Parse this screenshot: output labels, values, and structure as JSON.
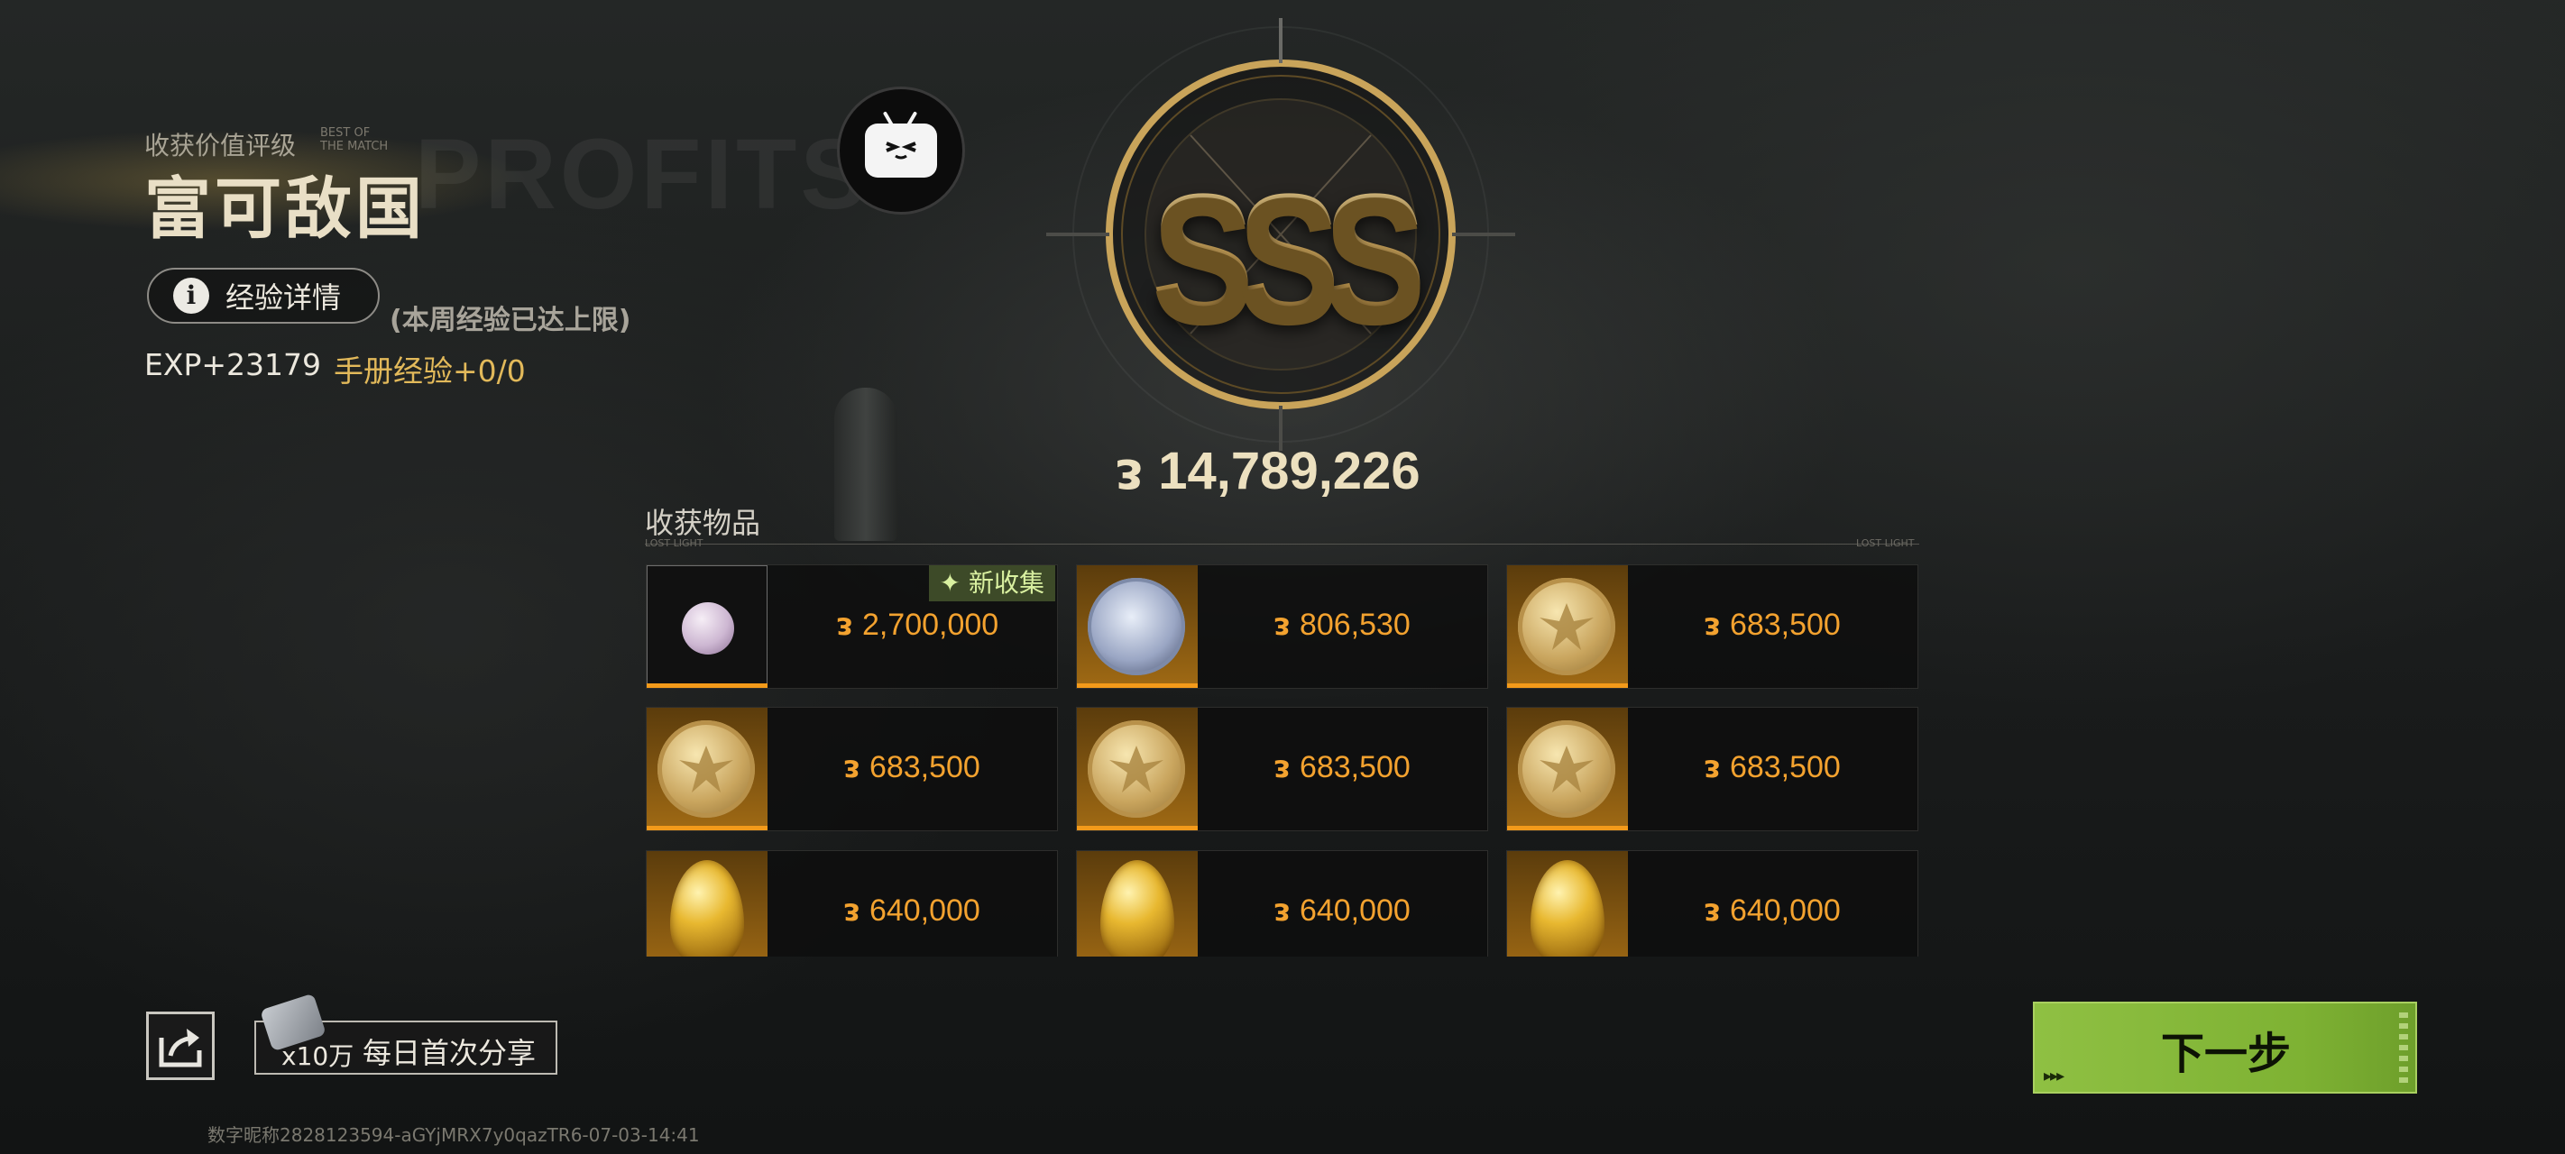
{
  "rating": {
    "label": "收获价值评级",
    "deco_line1": "BEST OF",
    "deco_line2": "THE MATCH",
    "title": "富可敌国",
    "grade": "SSS"
  },
  "background_word": "PROFITS",
  "experience": {
    "details_button": "经验详情",
    "limit_note": "(本周经验已达上限)",
    "exp": "EXP+23179",
    "manual_exp": "手册经验+0/0"
  },
  "total_value": "14,789,226",
  "currency_glyph": "ᴈ",
  "items": {
    "title": "收获物品",
    "rule_left": "LOST LIGHT",
    "rule_right": "LOST LIGHT",
    "new_tag": "✦ 新收集",
    "list": [
      {
        "name": "pebble",
        "price": "2,700,000"
      },
      {
        "name": "portrait-coin",
        "price": "806,530"
      },
      {
        "name": "gold-coin",
        "price": "683,500"
      },
      {
        "name": "gold-coin",
        "price": "683,500"
      },
      {
        "name": "gold-coin",
        "price": "683,500"
      },
      {
        "name": "gold-coin",
        "price": "683,500"
      },
      {
        "name": "golden-egg",
        "price": "640,000"
      },
      {
        "name": "golden-egg",
        "price": "640,000"
      },
      {
        "name": "golden-egg",
        "price": "640,000"
      }
    ]
  },
  "share": {
    "reward_qty": "x10万",
    "reward_text": "每日首次分享"
  },
  "next_button": "下一步",
  "footer_id": "数字昵称2828123594-aGYjMRX7y0qazTR6-07-03-14:41",
  "colors": {
    "accent_green": "#8fc043",
    "price_orange": "#f3a22f",
    "gold": "#c9a45a"
  }
}
